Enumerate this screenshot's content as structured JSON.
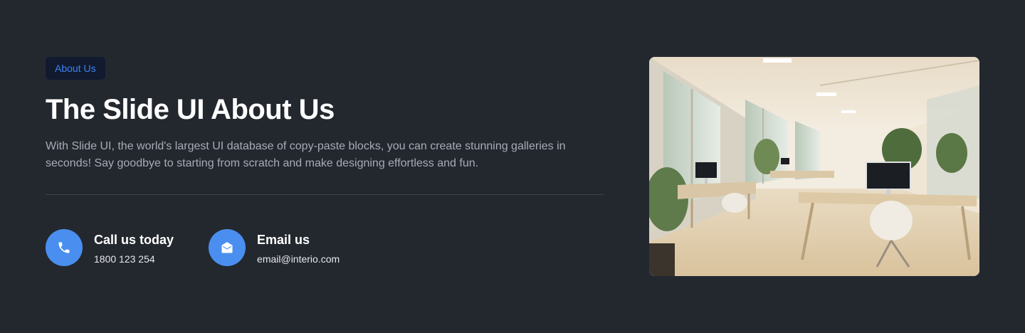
{
  "badge": {
    "label": "About Us"
  },
  "heading": {
    "title": "The Slide UI About Us"
  },
  "description": "With Slide UI, the world's largest UI database of copy-paste blocks, you can create stunning galleries in seconds! Say goodbye to starting from scratch and make designing effortless and fun.",
  "contacts": [
    {
      "title": "Call us today",
      "value": "1800 123 254",
      "icon": "phone-icon"
    },
    {
      "title": "Email us",
      "value": "email@interio.com",
      "icon": "mail-open-icon"
    }
  ],
  "image": {
    "subject": "office-interior"
  },
  "colors": {
    "background": "#23282f",
    "accent": "#4a8ff0",
    "badge_bg": "#111a2e",
    "badge_text": "#3b82f6"
  }
}
